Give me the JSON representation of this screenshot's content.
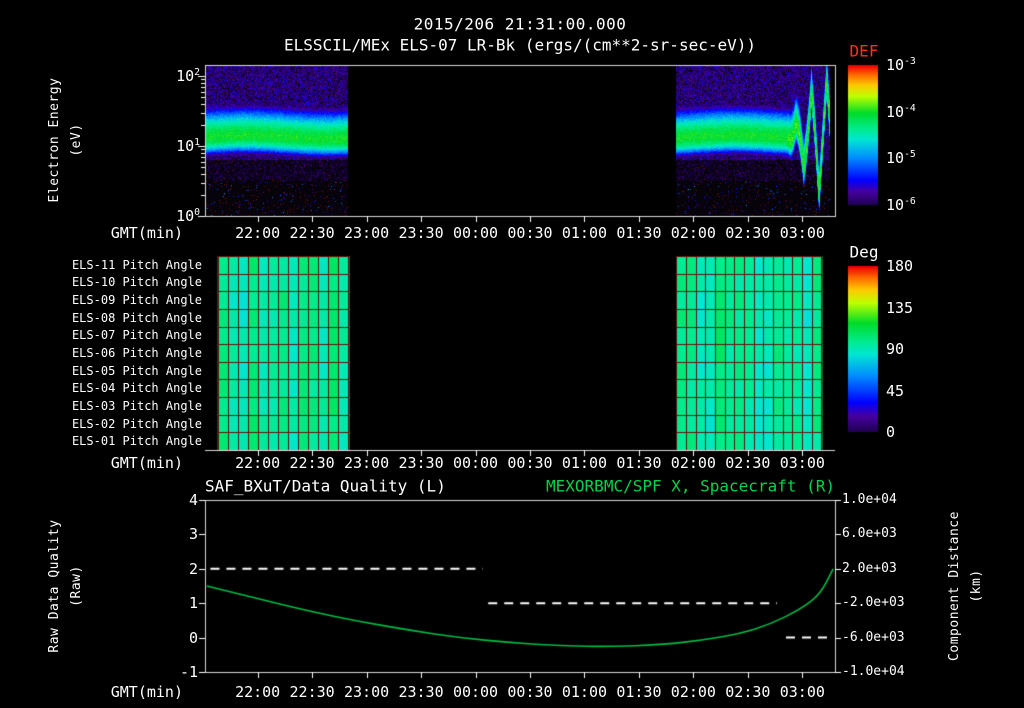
{
  "header": {
    "title": "2015/206 21:31:00.000",
    "subtitle": "ELSSCIL/MEx ELS-07 LR-Bk (ergs/(cm**2-sr-sec-eV))"
  },
  "colors": {
    "background": "#000000",
    "foreground": "#ffffff",
    "def_title": "#ff3214",
    "green_accent": "#00d24b",
    "pitch_grid": "#601408",
    "colormap": [
      [
        0,
        "#1e0050"
      ],
      [
        0.1,
        "#4600a0"
      ],
      [
        0.18,
        "#0000ff"
      ],
      [
        0.34,
        "#008cff"
      ],
      [
        0.47,
        "#00e6d2"
      ],
      [
        0.55,
        "#00eb8c"
      ],
      [
        0.66,
        "#00dc28"
      ],
      [
        0.78,
        "#beff00"
      ],
      [
        0.86,
        "#ffc800"
      ],
      [
        0.93,
        "#ff6e00"
      ],
      [
        1,
        "#eb0000"
      ]
    ]
  },
  "time_axis": {
    "label": "GMT(min)",
    "total_minutes": 347,
    "tick_minutes": [
      29,
      59,
      89,
      119,
      149,
      179,
      209,
      239,
      269,
      299,
      329
    ],
    "tick_labels": [
      "22:00",
      "22:30",
      "23:00",
      "23:30",
      "00:00",
      "00:30",
      "01:00",
      "01:30",
      "02:00",
      "02:30",
      "03:00"
    ]
  },
  "chart_data": [
    {
      "type": "heatmap",
      "name": "electron-energy-spectrogram",
      "ylabel_lines": [
        "Electron Energy",
        "(eV)"
      ],
      "yscale": "log",
      "ylim_ev": [
        1,
        145
      ],
      "ytick_exponents": [
        2,
        1,
        0
      ],
      "colorbar": {
        "title": "DEF",
        "scale": "log",
        "tick_exponents": [
          -3,
          -4,
          -5,
          -6
        ]
      },
      "segments_min": [
        [
          0.5,
          79
        ],
        [
          259.5,
          344
        ]
      ],
      "band": {
        "peak_energy_ev": 14,
        "peak_flux_exponent": -4.0,
        "width_dex": 0.3,
        "background_flux_exponent": -5.9,
        "disturbance_start_min": 321
      }
    },
    {
      "type": "heatmap",
      "name": "pitch-angle-panels",
      "row_labels": [
        "ELS-11 Pitch Angle",
        "ELS-10 Pitch Angle",
        "ELS-09 Pitch Angle",
        "ELS-08 Pitch Angle",
        "ELS-07 Pitch Angle",
        "ELS-06 Pitch Angle",
        "ELS-05 Pitch Angle",
        "ELS-04 Pitch Angle",
        "ELS-03 Pitch Angle",
        "ELS-02 Pitch Angle",
        "ELS-01 Pitch Angle"
      ],
      "colorbar": {
        "title": "Deg",
        "ticks": [
          180,
          135,
          90,
          45,
          0
        ]
      },
      "segments_min": [
        [
          7,
          79
        ],
        [
          259.5,
          339.5
        ]
      ],
      "typical_value_deg": 95
    },
    {
      "type": "line",
      "name": "data-quality-and-spacecraft-position",
      "title_left": {
        "text": "SAF_BXuT/Data Quality (L)",
        "color": "#ffffff"
      },
      "title_right": {
        "text": "MEXORBMC/SPF X, Spacecraft (R)",
        "color": "#00d24b"
      },
      "left_axis": {
        "label_lines": [
          "Raw Data Quality",
          "(Raw)"
        ],
        "ylim": [
          -1,
          4
        ],
        "ticks": [
          4,
          3,
          2,
          1,
          0,
          -1
        ]
      },
      "right_axis": {
        "label_lines": [
          "Component Distance",
          "(km)"
        ],
        "ylim_km": [
          -10000,
          10000
        ],
        "tick_labels": [
          "1.0e+04",
          "6.0e+03",
          "2.0e+03",
          "-2.0e+03",
          "-6.0e+03",
          "-1.0e+04"
        ]
      },
      "series": [
        {
          "name": "SAF_BXuT Data Quality",
          "axis": "left",
          "style": "dashed",
          "color": "#ffffff",
          "steps": [
            {
              "value": 2,
              "from_min": 3,
              "to_min": 153
            },
            {
              "value": 1,
              "from_min": 156,
              "to_min": 315
            },
            {
              "value": 0,
              "from_min": 320,
              "to_min": 345
            }
          ]
        },
        {
          "name": "MEXORBMC/SPF X Spacecraft",
          "axis": "right",
          "style": "solid",
          "color": "#00bd46",
          "points_min_km": [
            [
              1,
              0
            ],
            [
              30,
              -1520
            ],
            [
              58,
              -2960
            ],
            [
              85,
              -4120
            ],
            [
              113,
              -5160
            ],
            [
              140,
              -6000
            ],
            [
              168,
              -6590
            ],
            [
              196,
              -6940
            ],
            [
              223,
              -7060
            ],
            [
              251,
              -6820
            ],
            [
              273,
              -6350
            ],
            [
              295,
              -5530
            ],
            [
              311,
              -4470
            ],
            [
              328,
              -2710
            ],
            [
              339,
              -940
            ],
            [
              346,
              2000
            ]
          ]
        }
      ]
    }
  ]
}
